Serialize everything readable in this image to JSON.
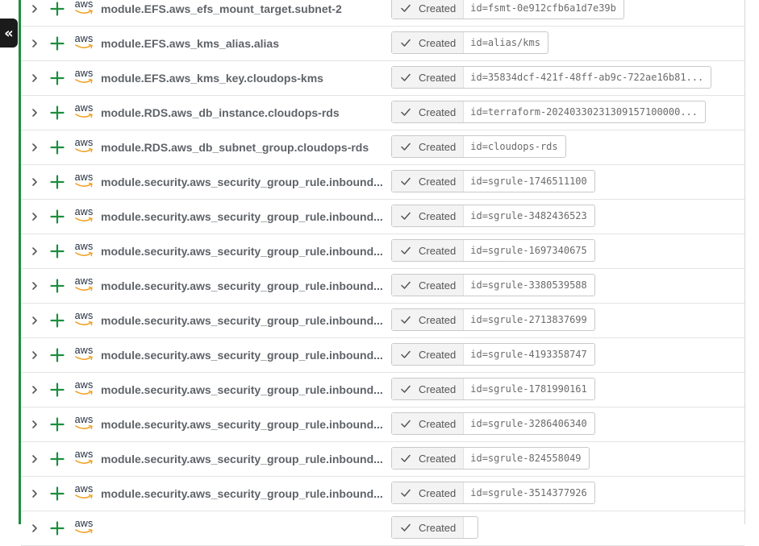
{
  "sidebar": {
    "collapse_label": "«"
  },
  "status_label": "Created",
  "colors": {
    "accent_green": "#1e8e3e",
    "plus_green": "#1e8e3e"
  },
  "icons": {
    "expand": "chevron-right-icon",
    "added": "plus-icon",
    "provider": "aws-logo",
    "status": "check-icon"
  },
  "provider_logo_text": "aws",
  "rows": [
    {
      "name": "module.EFS.aws_efs_mount_target.subnet-2",
      "id": "id=fsmt-0e912cfb6a1d7e39b"
    },
    {
      "name": "module.EFS.aws_kms_alias.alias",
      "id": "id=alias/kms"
    },
    {
      "name": "module.EFS.aws_kms_key.cloudops-kms",
      "id": "id=35834dcf-421f-48ff-ab9c-722ae16b81..."
    },
    {
      "name": "module.RDS.aws_db_instance.cloudops-rds",
      "id": "id=terraform-20240330231309157100000..."
    },
    {
      "name": "module.RDS.aws_db_subnet_group.cloudops-rds",
      "id": "id=cloudops-rds"
    },
    {
      "name": "module.security.aws_security_group_rule.inbound...",
      "id": "id=sgrule-1746511100"
    },
    {
      "name": "module.security.aws_security_group_rule.inbound...",
      "id": "id=sgrule-3482436523"
    },
    {
      "name": "module.security.aws_security_group_rule.inbound...",
      "id": "id=sgrule-1697340675"
    },
    {
      "name": "module.security.aws_security_group_rule.inbound...",
      "id": "id=sgrule-3380539588"
    },
    {
      "name": "module.security.aws_security_group_rule.inbound...",
      "id": "id=sgrule-2713837699"
    },
    {
      "name": "module.security.aws_security_group_rule.inbound...",
      "id": "id=sgrule-4193358747"
    },
    {
      "name": "module.security.aws_security_group_rule.inbound...",
      "id": "id=sgrule-1781990161"
    },
    {
      "name": "module.security.aws_security_group_rule.inbound...",
      "id": "id=sgrule-3286406340"
    },
    {
      "name": "module.security.aws_security_group_rule.inbound...",
      "id": "id=sgrule-824558049"
    },
    {
      "name": "module.security.aws_security_group_rule.inbound...",
      "id": "id=sgrule-3514377926"
    },
    {
      "name": "",
      "id": ""
    }
  ]
}
